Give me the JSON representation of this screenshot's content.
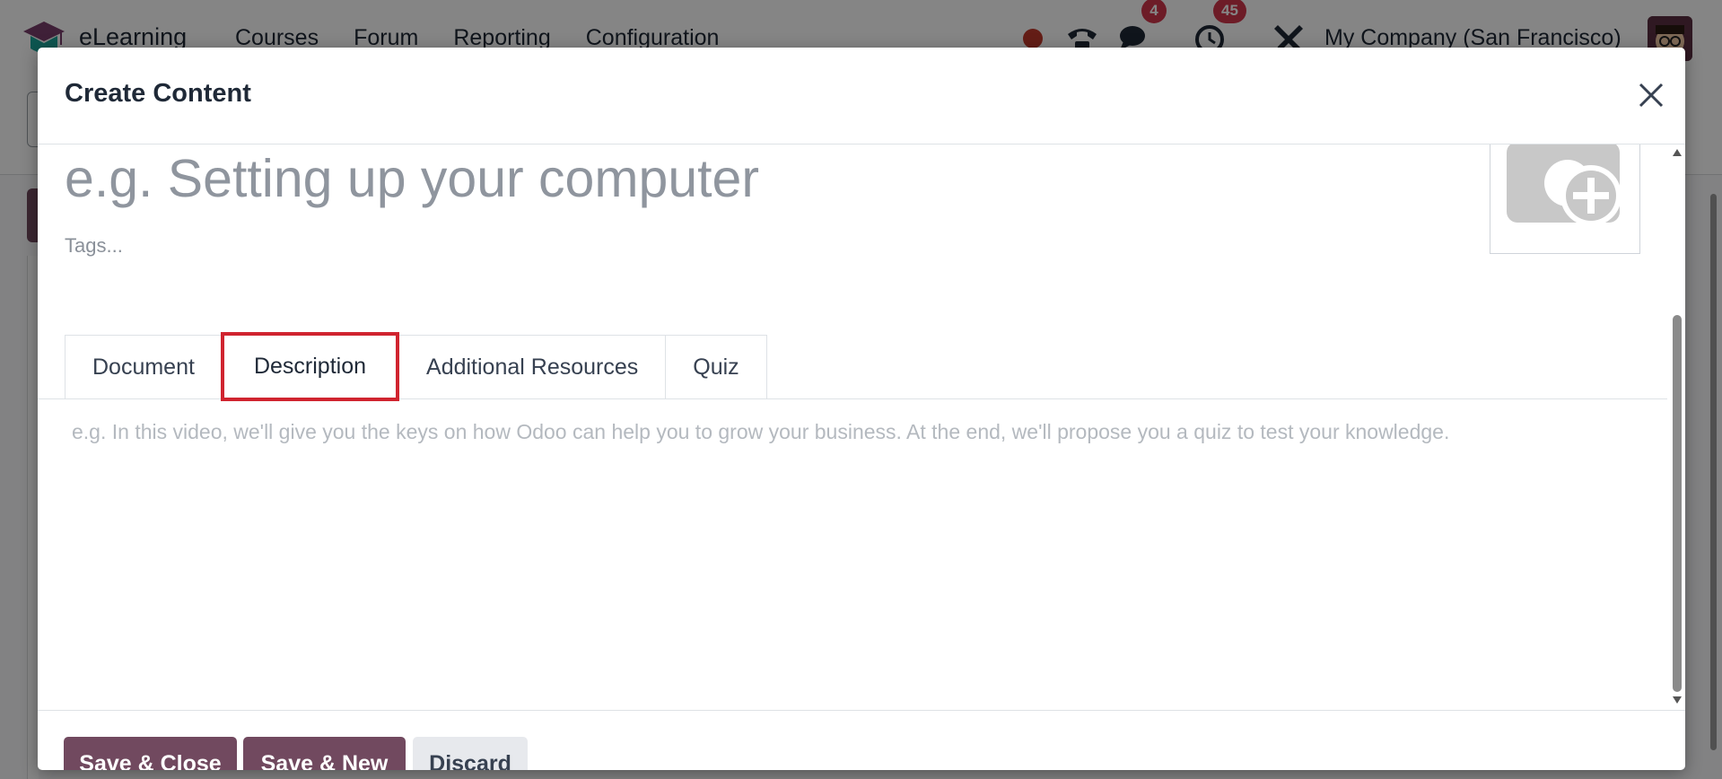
{
  "navbar": {
    "app_name": "eLearning",
    "menu": [
      "Courses",
      "Forum",
      "Reporting",
      "Configuration"
    ],
    "messages_badge": "4",
    "activities_badge": "45",
    "company": "My Company (San Francisco)"
  },
  "dialog": {
    "title": "Create Content",
    "title_placeholder": "e.g. Setting up your computer",
    "tags_placeholder": "Tags...",
    "tabs": [
      "Document",
      "Description",
      "Additional Resources",
      "Quiz"
    ],
    "active_tab": "Description",
    "description_placeholder": "e.g. In this video, we'll give you the keys on how Odoo can help you to grow your business. At the end, we'll propose you a quiz to test your knowledge.",
    "buttons": {
      "save_close": "Save & Close",
      "save_new": "Save & New",
      "discard": "Discard"
    }
  },
  "colors": {
    "primary": "#71495f",
    "highlight": "#d0242f",
    "badge": "#d1364b"
  }
}
